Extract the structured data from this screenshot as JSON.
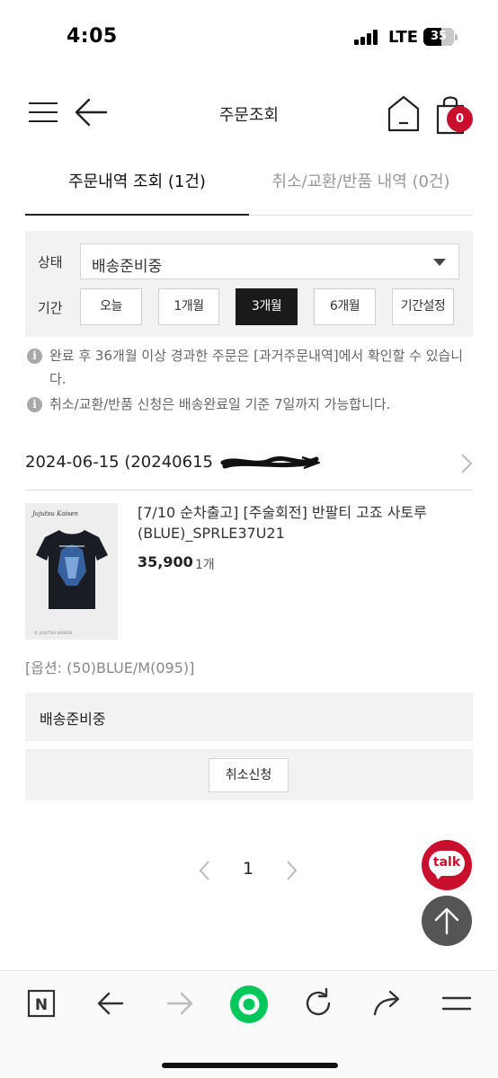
{
  "status_bar": {
    "time": "4:05",
    "network": "LTE",
    "battery": "35"
  },
  "header": {
    "title": "주문조회",
    "cart_count": "0"
  },
  "tabs": [
    {
      "label": "주문내역 조회 (1건)",
      "active": true
    },
    {
      "label": "취소/교환/반품 내역 (0건)",
      "active": false
    }
  ],
  "filter": {
    "status_label": "상태",
    "status_value": "배송준비중",
    "period_label": "기간",
    "periods": [
      {
        "label": "오늘",
        "active": false
      },
      {
        "label": "1개월",
        "active": false
      },
      {
        "label": "3개월",
        "active": true
      },
      {
        "label": "6개월",
        "active": false
      },
      {
        "label": "기간설정",
        "active": false
      }
    ]
  },
  "notices": {
    "icon": "i",
    "line1": "완료 후 36개월 이상 경과한 주문은 [과거주문내역]에서 확인할 수 있습니다.",
    "line2": "취소/교환/반품 신청은 배송완료일 기준 7일까지 가능합니다."
  },
  "order": {
    "date": "2024-06-15 (20240615",
    "product_name": "[7/10 순차출고] [주술회전] 반팔티 고죠 사토루 (BLUE)_SPRLE37U21",
    "price": "35,900",
    "quantity": "1개",
    "option": "[옵션: (50)BLUE/M(095)]",
    "status": "배송준비중",
    "cancel_label": "취소신청"
  },
  "pagination": {
    "current": "1"
  },
  "floating": {
    "talk_label": "talk"
  },
  "bottom_bar": {
    "naver_label": "N"
  },
  "colors": {
    "accent": "#c8102e",
    "active_button": "#1a1a1a",
    "panel_bg": "#f2f2f2"
  }
}
